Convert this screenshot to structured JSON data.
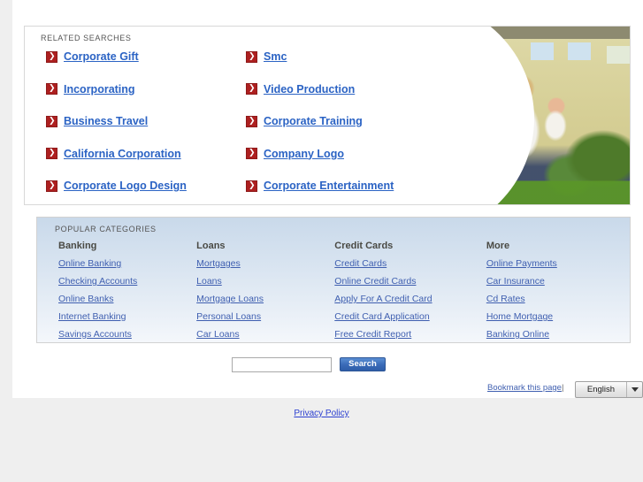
{
  "topbar": {
    "color": "#4185c9"
  },
  "related": {
    "title": "RELATED SEARCHES",
    "rows": [
      {
        "left": "Corporate Gift",
        "right": "Smc"
      },
      {
        "left": "Incorporating",
        "right": "Video Production"
      },
      {
        "left": "Business Travel",
        "right": "Corporate Training"
      },
      {
        "left": "California Corporation",
        "right": "Company Logo"
      },
      {
        "left": "Corporate Logo Design",
        "right": "Corporate Entertainment"
      }
    ],
    "link_color": "#2b63c4",
    "bullet_color": "#ad2020"
  },
  "hero": {
    "alt": "family-with-baby-in-front-of-house-photo"
  },
  "categories": {
    "title": "POPULAR CATEGORIES",
    "columns": [
      {
        "heading": "Banking",
        "links": [
          "Online Banking",
          "Checking Accounts",
          "Online Banks",
          "Internet Banking",
          "Savings Accounts"
        ]
      },
      {
        "heading": "Loans",
        "links": [
          "Mortgages",
          "Loans",
          "Mortgage Loans",
          "Personal Loans",
          "Car Loans"
        ]
      },
      {
        "heading": "Credit Cards",
        "links": [
          "Credit Cards",
          "Online Credit Cards",
          "Apply For A Credit Card",
          "Credit Card Application",
          "Free Credit Report"
        ]
      },
      {
        "heading": "More",
        "links": [
          "Online Payments",
          "Car Insurance",
          "Cd Rates",
          "Home Mortgage",
          "Banking Online"
        ]
      }
    ],
    "link_color": "#3f5fb0"
  },
  "search": {
    "value": "",
    "placeholder": "",
    "button_label": "Search",
    "button_color": "#3a6bb8"
  },
  "footer": {
    "bookmark_label": "Bookmark this page",
    "separator": "|",
    "language": "English",
    "privacy_label": "Privacy Policy"
  }
}
